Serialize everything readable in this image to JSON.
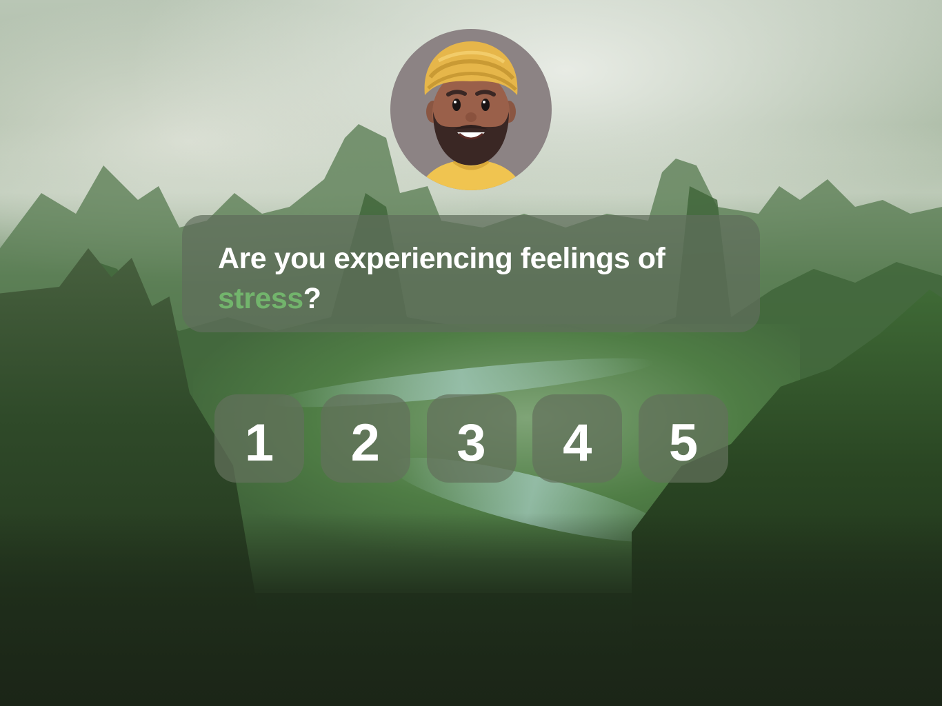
{
  "question": {
    "prefix": "Are you experiencing feelings of",
    "highlight": "stress",
    "suffix": "?"
  },
  "rating": {
    "options": [
      "1",
      "2",
      "3",
      "4",
      "5"
    ]
  },
  "colors": {
    "highlight": "#72b46c",
    "card": "#5f6e5c",
    "text": "#ffffff"
  },
  "icons": {
    "avatar": "avatar-turban-man-icon"
  }
}
